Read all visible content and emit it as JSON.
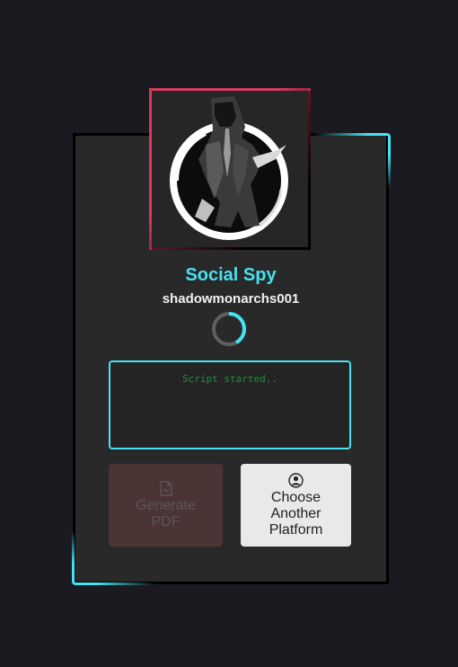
{
  "app": {
    "title": "Social Spy",
    "username": "shadowmonarchs001"
  },
  "colors": {
    "background": "#1b1a21",
    "card": "#292929",
    "accent_cyan": "#45e3f3",
    "accent_pink": "#d63a5f",
    "console_text": "#1e8f3a"
  },
  "status": {
    "loading": true
  },
  "console": {
    "log": "Script started.."
  },
  "actions": {
    "generate_pdf": {
      "label": "Generate\nPDF",
      "icon": "file-pdf-icon",
      "disabled": true
    },
    "choose_platform": {
      "label": "Choose\nAnother\nPlatform",
      "icon": "user-circle-icon"
    }
  }
}
